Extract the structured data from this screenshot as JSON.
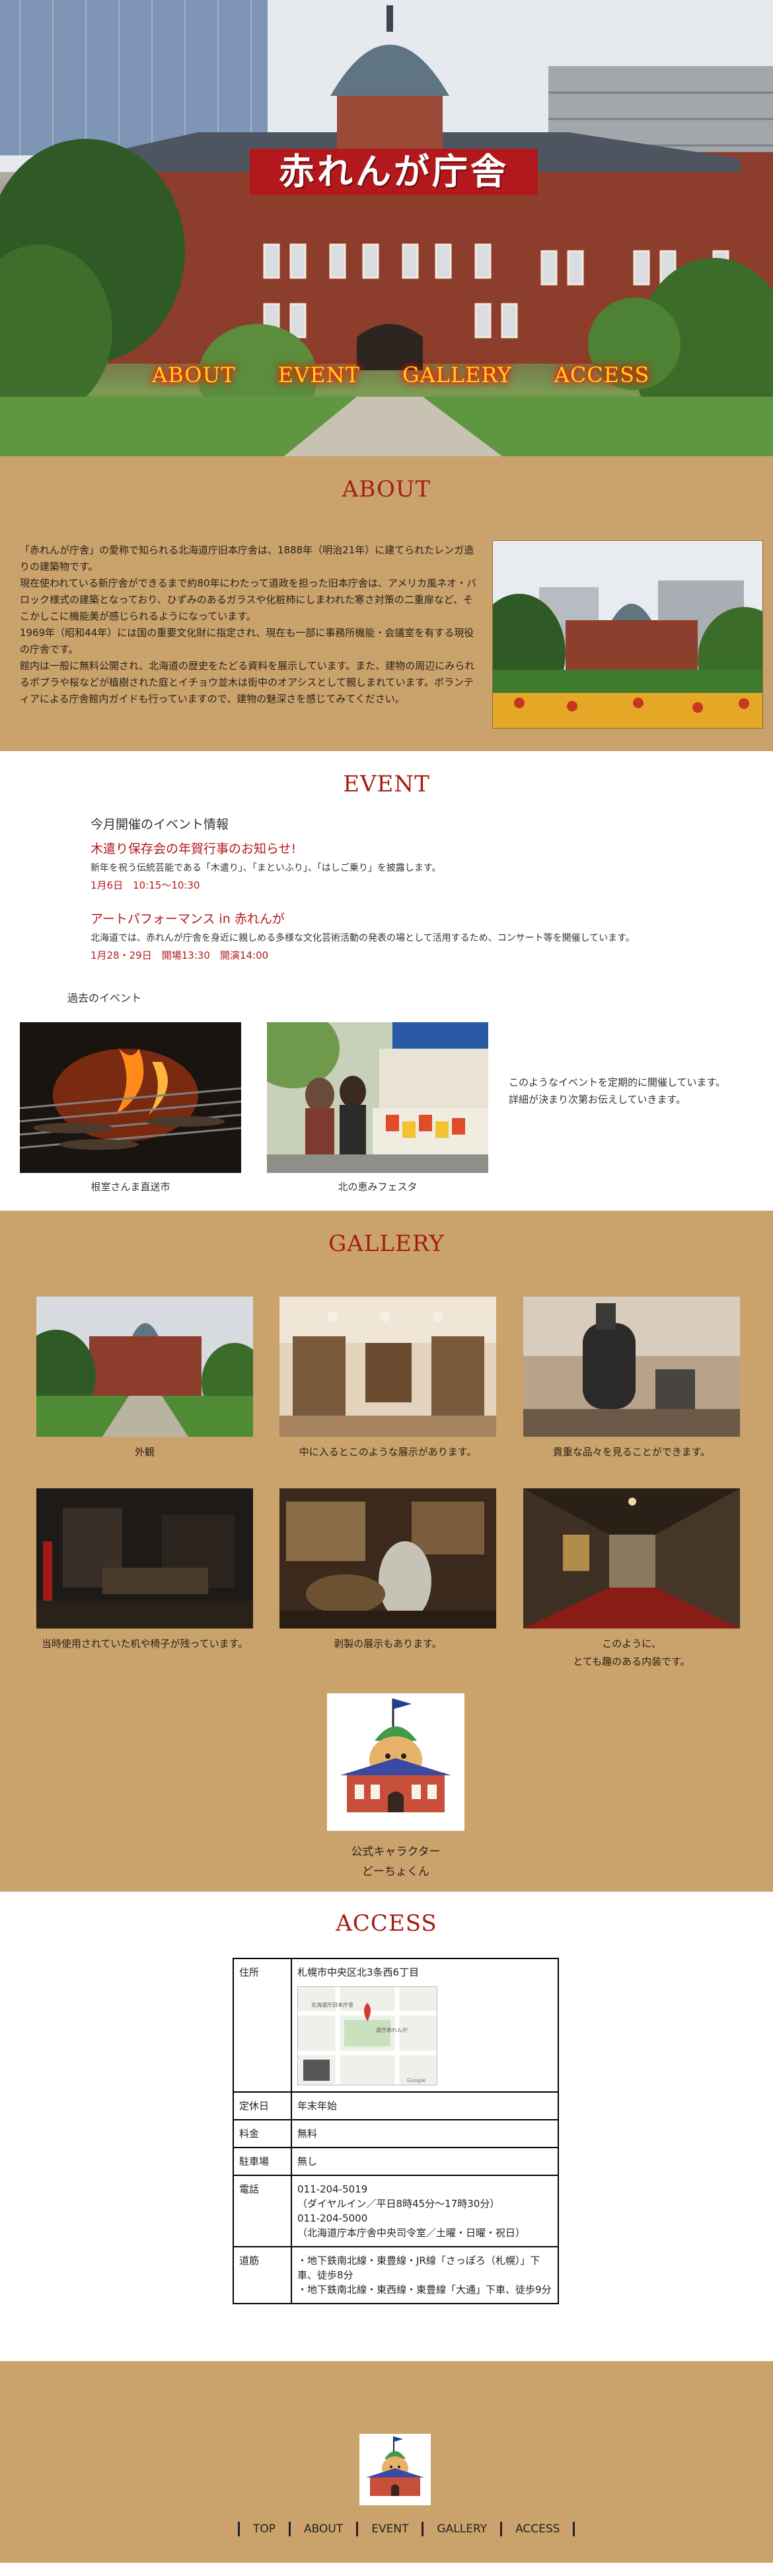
{
  "hero": {
    "title": "赤れんが庁舎",
    "nav": [
      "ABOUT",
      "EVENT",
      "GALLERY",
      "ACCESS"
    ]
  },
  "about": {
    "heading": "ABOUT",
    "paragraphs": [
      "「赤れんが庁舎」の愛称で知られる北海道庁旧本庁舎は、1888年（明治21年）に建てられたレンガ造りの建築物です。",
      "現在使われている新庁舎ができるまで約80年にわたって道政を担った旧本庁舎は、アメリカ風ネオ・バロック様式の建築となっており、ひずみのあるガラスや化粧柿にしまわれた寒さ対策の二重扉など、そこかしこに機能美が感じられるようになっています。",
      "1969年（昭和44年）には国の重要文化財に指定され、現在も一部に事務所機能・会議室を有する現役の庁舎です。",
      "館内は一般に無料公開され、北海道の歴史をたどる資料を展示しています。また、建物の周辺にみられるポプラや桜などが植樹された庭とイチョウ並木は街中のオアシスとして親しまれています。ボランティアによる庁舎館内ガイドも行っていますので、建物の魅深さを感じてみてください。"
    ]
  },
  "event": {
    "heading": "EVENT",
    "current_heading": "今月開催のイベント情報",
    "items": [
      {
        "title": "木遣り保存会の年賀行事のお知らせ!",
        "desc": "新年を祝う伝統芸能である「木遣り」、「まといふり」、「はしご乗り」を披露します。",
        "date": "1月6日　10:15〜10:30"
      },
      {
        "title": "アートパフォーマンス in 赤れんが",
        "desc": "北海道では、赤れんが庁舎を身近に親しめる多様な文化芸術活動の発表の場として活用するため、コンサート等を開催しています。",
        "date": "1月28・29日　開場13:30　開演14:00"
      }
    ],
    "past_label": "過去のイベント",
    "past": [
      {
        "caption": "根室さんま直送市"
      },
      {
        "caption": "北の恵みフェスタ"
      }
    ],
    "note": [
      "このようなイベントを定期的に開催しています。",
      "詳細が決まり次第お伝えしていきます。"
    ]
  },
  "gallery": {
    "heading": "GALLERY",
    "items": [
      {
        "caption": "外観"
      },
      {
        "caption": "中に入るとこのような展示があります。"
      },
      {
        "caption": "貴重な品々を見ることができます。"
      },
      {
        "caption": "当時使用されていた机や椅子が残っています。"
      },
      {
        "caption": "剥製の展示もあります。"
      },
      {
        "caption": "このように、\nとても趣のある内装です。"
      }
    ],
    "mascot_caption": [
      "公式キャラクター",
      "どーちょくん"
    ]
  },
  "access": {
    "heading": "ACCESS",
    "rows": [
      {
        "key": "住所",
        "value": [
          "札幌市中央区北3条西6丁目"
        ]
      },
      {
        "key": "定休日",
        "value": [
          "年末年始"
        ]
      },
      {
        "key": "料金",
        "value": [
          "無料"
        ]
      },
      {
        "key": "駐車場",
        "value": [
          "無し"
        ]
      },
      {
        "key": "電話",
        "value": [
          "011-204-5019",
          "（ダイヤルイン／平日8時45分〜17時30分）",
          "011-204-5000",
          "（北海道庁本庁舎中央司令室／土曜・日曜・祝日）"
        ]
      },
      {
        "key": "道筋",
        "value": [
          "・地下鉄南北線・東豊線・JR線「さっぽろ（札幌）」下車、徒歩8分",
          "・地下鉄南北線・東西線・東豊線「大通」下車、徒歩9分"
        ]
      }
    ],
    "map_labels": [
      "北海道庁旧本庁舎",
      "道庁赤れんが",
      "Google"
    ]
  },
  "footer": {
    "nav": [
      "TOP",
      "ABOUT",
      "EVENT",
      "GALLERY",
      "ACCESS"
    ]
  },
  "colors": {
    "accent": "#a51d12",
    "tan": "#c9a26c",
    "hero_title_bg": "#b3191c",
    "nav_glow": "#ff1e00"
  }
}
